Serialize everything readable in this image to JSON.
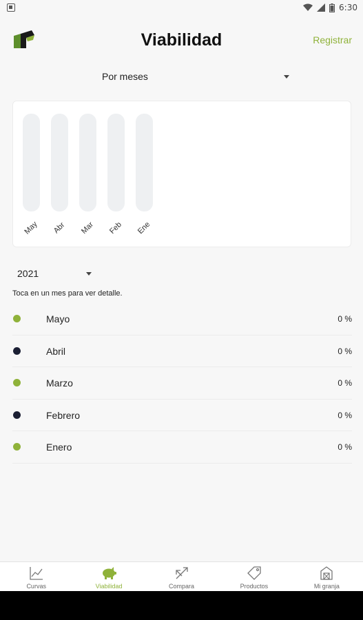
{
  "status_bar": {
    "time": "6:30"
  },
  "header": {
    "title": "Viabilidad",
    "register_label": "Registrar"
  },
  "period_selector": {
    "value": "Por meses"
  },
  "chart_data": {
    "type": "bar",
    "categories": [
      "May",
      "Abr",
      "Mar",
      "Feb",
      "Ene"
    ],
    "values": [
      0,
      0,
      0,
      0,
      0
    ],
    "ylim": [
      0,
      100
    ],
    "title": "",
    "xlabel": "",
    "ylabel": ""
  },
  "year_selector": {
    "value": "2021"
  },
  "hint": "Toca en un mes para ver detalle.",
  "months": [
    {
      "name": "Mayo",
      "value": "0 %",
      "dot_color": "#8fb23a"
    },
    {
      "name": "Abril",
      "value": "0 %",
      "dot_color": "#1b1f33"
    },
    {
      "name": "Marzo",
      "value": "0 %",
      "dot_color": "#8fb23a"
    },
    {
      "name": "Febrero",
      "value": "0 %",
      "dot_color": "#1b1f33"
    },
    {
      "name": "Enero",
      "value": "0 %",
      "dot_color": "#8fb23a"
    }
  ],
  "bottom_nav": [
    {
      "label": "Curvas",
      "icon": "line-chart-icon",
      "active": false
    },
    {
      "label": "Viabilidad",
      "icon": "pig-icon",
      "active": true
    },
    {
      "label": "Compara",
      "icon": "compare-arrows-icon",
      "active": false
    },
    {
      "label": "Productos",
      "icon": "tag-icon",
      "active": false
    },
    {
      "label": "Mi granja",
      "icon": "barn-icon",
      "active": false
    }
  ],
  "colors": {
    "accent": "#8fb23a",
    "dark": "#1b1f33",
    "track": "#eef0f2"
  }
}
